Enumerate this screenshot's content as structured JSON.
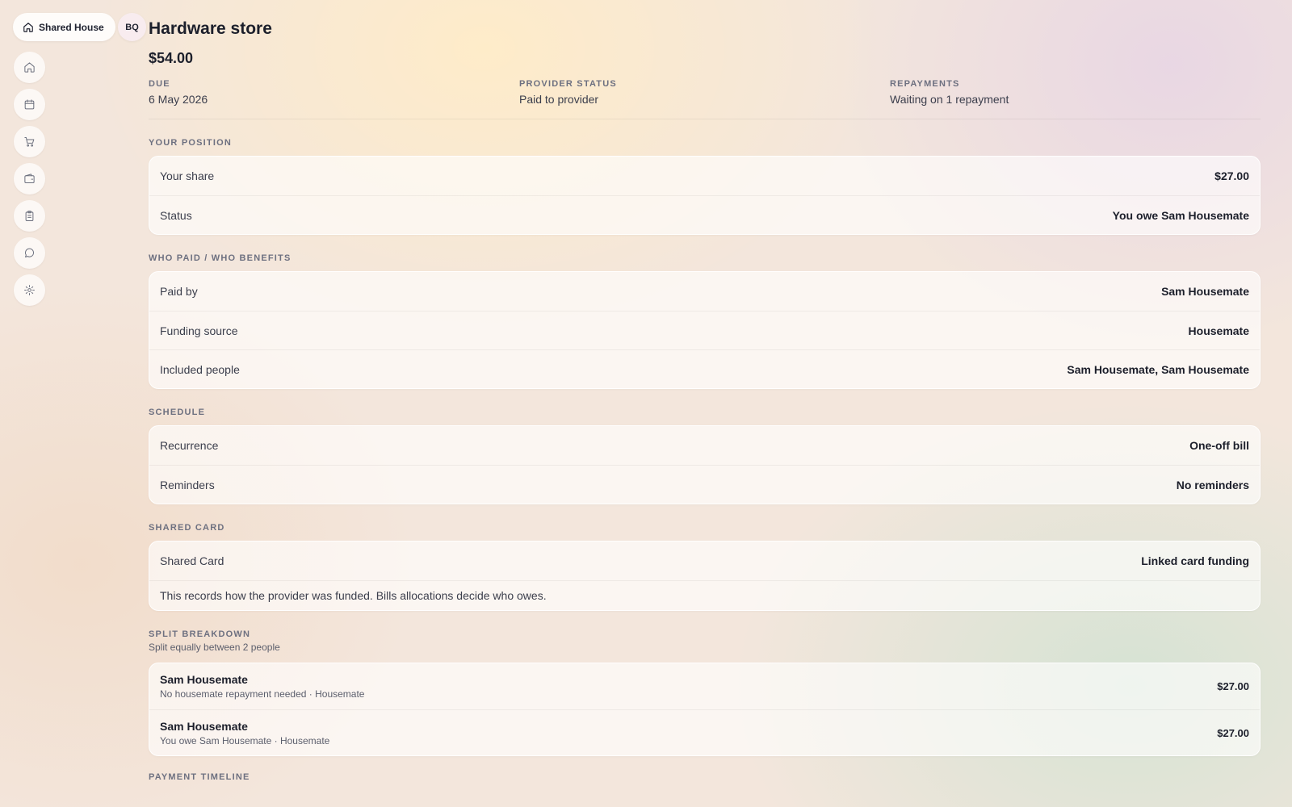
{
  "nav": {
    "house_label": "Shared House",
    "avatar_initials": "BQ",
    "rail_icons": [
      "home-icon",
      "calendar-icon",
      "cart-icon",
      "wallet-icon",
      "clipboard-icon",
      "chat-icon",
      "gear-icon"
    ]
  },
  "bill": {
    "title": "Hardware store",
    "amount": "$54.00",
    "meta": [
      {
        "label": "DUE",
        "value": "6 May 2026"
      },
      {
        "label": "PROVIDER STATUS",
        "value": "Paid to provider"
      },
      {
        "label": "REPAYMENTS",
        "value": "Waiting on 1 repayment"
      }
    ]
  },
  "your_position": {
    "label": "YOUR POSITION",
    "rows": [
      {
        "key": "Your share",
        "value": "$27.00"
      },
      {
        "key": "Status",
        "value": "You owe Sam Housemate"
      }
    ]
  },
  "who_paid": {
    "label": "WHO PAID / WHO BENEFITS",
    "rows": [
      {
        "key": "Paid by",
        "value": "Sam Housemate"
      },
      {
        "key": "Funding source",
        "value": "Housemate"
      },
      {
        "key": "Included people",
        "value": "Sam Housemate, Sam Housemate"
      }
    ]
  },
  "schedule": {
    "label": "SCHEDULE",
    "rows": [
      {
        "key": "Recurrence",
        "value": "One-off bill"
      },
      {
        "key": "Reminders",
        "value": "No reminders"
      }
    ]
  },
  "shared_card": {
    "label": "SHARED CARD",
    "rows": [
      {
        "key": "Shared Card",
        "value": "Linked card funding"
      }
    ],
    "note": "This records how the provider was funded. Bills allocations decide who owes."
  },
  "split": {
    "label": "SPLIT BREAKDOWN",
    "subtitle": "Split equally between 2 people",
    "people": [
      {
        "name": "Sam Housemate",
        "detail": "No housemate repayment needed · Housemate",
        "amount": "$27.00"
      },
      {
        "name": "Sam Housemate",
        "detail": "You owe Sam Housemate · Housemate",
        "amount": "$27.00"
      }
    ]
  },
  "timeline": {
    "label": "PAYMENT TIMELINE"
  }
}
